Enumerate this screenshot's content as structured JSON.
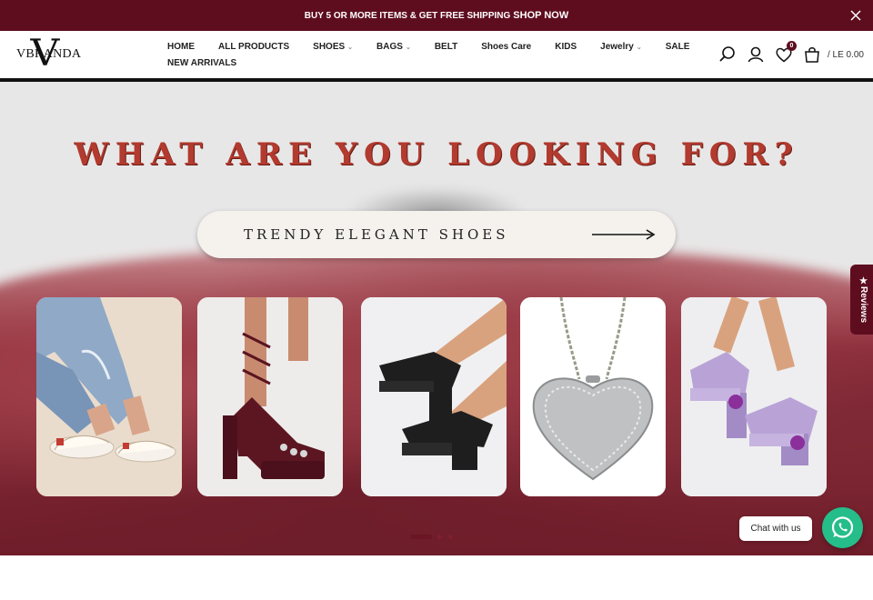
{
  "announcement": {
    "text": "BUY 5 OR MORE ITEMS & GET FREE SHIPPING",
    "cta": "SHOP NOW"
  },
  "brand": {
    "logo_text": "VBRANDA",
    "logo_mark": "V"
  },
  "nav": {
    "items": [
      {
        "label": "HOME",
        "dropdown": false
      },
      {
        "label": "ALL PRODUCTS",
        "dropdown": false
      },
      {
        "label": "SHOES",
        "dropdown": true
      },
      {
        "label": "BAGS",
        "dropdown": true
      },
      {
        "label": "BELT",
        "dropdown": false
      },
      {
        "label": "Shoes Care",
        "dropdown": false
      },
      {
        "label": "KIDS",
        "dropdown": false
      },
      {
        "label": "Jewelry",
        "dropdown": true
      },
      {
        "label": "SALE",
        "dropdown": false
      },
      {
        "label": "NEW ARRIVALS",
        "dropdown": false
      }
    ]
  },
  "header_icons": {
    "search": "search-icon",
    "account": "user-icon",
    "wishlist": "heart-icon",
    "wishlist_count": "0",
    "cart": "bag-icon",
    "cart_total": "/ LE 0.00"
  },
  "hero": {
    "title": "WHAT ARE YOU LOOKING FOR?",
    "search_pill": "TRENDY ELEGANT SHOES",
    "cards": [
      {
        "name": "white-sneakers"
      },
      {
        "name": "burgundy-lace-up-platform-heels"
      },
      {
        "name": "black-strappy-block-heels"
      },
      {
        "name": "silver-heart-clutch-bag"
      },
      {
        "name": "lilac-platform-heels"
      }
    ],
    "slides": {
      "active": 1,
      "total": 3
    }
  },
  "reviews_tab": {
    "label": "★Reviews"
  },
  "chat": {
    "label": "Chat with us",
    "icon": "whatsapp-icon"
  },
  "colors": {
    "brand": "#5e0d1f",
    "title": "#b23a2e",
    "chat": "#25bd8a"
  }
}
